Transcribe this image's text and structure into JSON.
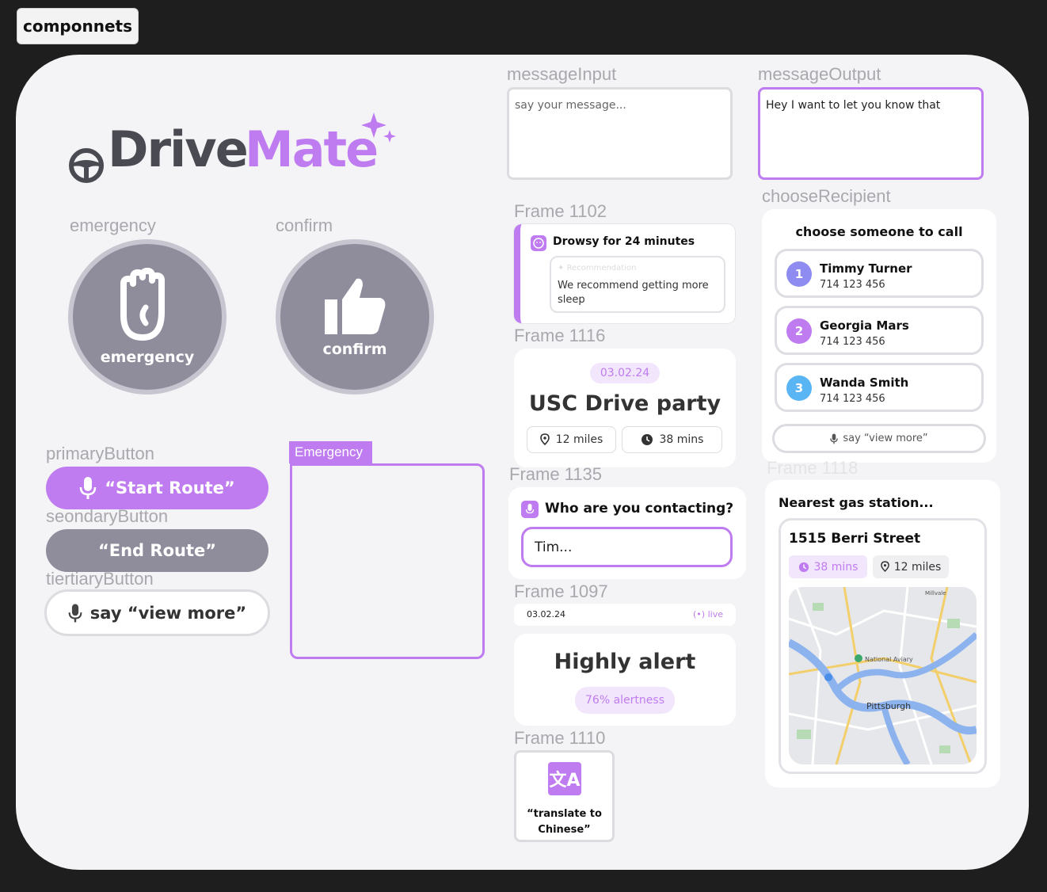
{
  "tag_label": "componnets",
  "logo": {
    "drive": "Drive",
    "mate": "Mate"
  },
  "labels": {
    "emergency": "emergency",
    "confirm": "confirm",
    "primary": "primaryButton",
    "secondary": "seondaryButton",
    "tertiary": "tiertiaryButton",
    "emergency_frame": "Emergency",
    "message_input": "messageInput",
    "message_output": "messageOutput",
    "frame1102": "Frame 1102",
    "frame1116": "Frame 1116",
    "frame1135": "Frame 1135",
    "frame1097": "Frame 1097",
    "frame1110": "Frame 1110",
    "choose_recipient": "chooseRecipient",
    "frame_hidden": "Frame 1118"
  },
  "emergency_button": {
    "text": "emergency"
  },
  "confirm_button": {
    "text": "confirm"
  },
  "primary_button": {
    "text": "“Start Route”"
  },
  "secondary_button": {
    "text": "“End Route”"
  },
  "tertiary_button": {
    "text": "say “view more”"
  },
  "message_input": {
    "placeholder": "say your message..."
  },
  "message_output": {
    "text": "Hey I want to let you know that"
  },
  "drowsy": {
    "title": "Drowsy for 24 minutes",
    "rec_label": "Recommendation",
    "rec_text": "We recommend getting more sleep"
  },
  "event": {
    "date": "03.02.24",
    "title": "USC Drive party",
    "distance": "12 miles",
    "duration": "38 mins"
  },
  "contacting": {
    "question": "Who are you contacting?",
    "value": "Tim..."
  },
  "live_bar": {
    "date": "03.02.24",
    "status": "live"
  },
  "alert": {
    "title": "Highly alert",
    "badge": "76% alertness"
  },
  "translate": {
    "text": "“translate to Chinese”"
  },
  "recipient": {
    "title": "choose someone to call",
    "contacts": [
      {
        "num": "1",
        "name": "Timmy Turner",
        "phone": "714 123 456",
        "color": "#8e8cf0"
      },
      {
        "num": "2",
        "name": "Georgia Mars",
        "phone": "714 123 456",
        "color": "#bf7cf0"
      },
      {
        "num": "3",
        "name": "Wanda Smith",
        "phone": "714 123 456",
        "color": "#5ab5f5"
      }
    ],
    "more": "say “view more”"
  },
  "gas": {
    "title": "Nearest gas station...",
    "street": "1515 Berri Street",
    "duration": "38 mins",
    "distance": "12 miles",
    "map_labels": {
      "city": "Pittsburgh",
      "poi": "National Aviary",
      "area": "Millvale"
    }
  },
  "colors": {
    "purple": "#bf7cf0",
    "gray": "#8f8d9c",
    "dark": "#4a4a52"
  }
}
